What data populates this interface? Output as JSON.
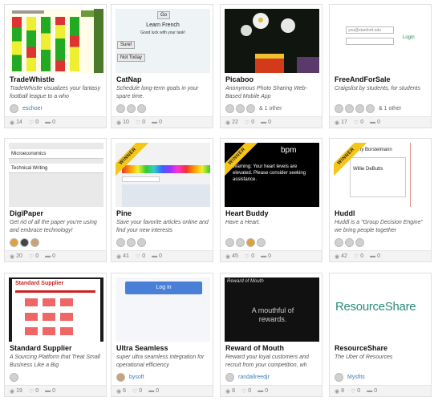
{
  "cards": [
    {
      "title": "TradeWhistle",
      "desc": "TradeWhistle visualizes your fantasy football league to a who",
      "user": "eschoer",
      "views": "14",
      "likes": "0",
      "comments": "0"
    },
    {
      "title": "CatNap",
      "desc": "Schedule long-term goals in your spare time.",
      "thumb": {
        "go": "Go",
        "heading": "Learn French",
        "sub": "Good luck with your task!",
        "sure": "Sure!",
        "nottoday": "Not Today"
      },
      "views": "10",
      "likes": "0",
      "comments": "0"
    },
    {
      "title": "Picaboo",
      "desc": "Anonymous Photo Sharing Web-Based Mobile App",
      "others": "& 1 other",
      "views": "22",
      "likes": "0",
      "comments": "0"
    },
    {
      "title": "FreeAndForSale",
      "desc": "Craigslist by students, for students",
      "thumb": {
        "email": "you@stanford.edu",
        "login": "Login"
      },
      "others": "& 1 other",
      "views": "17",
      "likes": "0",
      "comments": "0"
    },
    {
      "title": "DigiPaper",
      "desc": "Get rid of all the paper you're using and embrace technology!",
      "thumb": {
        "line1": "Microeconomics",
        "line2": "Technical Writing"
      },
      "views": "20",
      "likes": "0",
      "comments": "0"
    },
    {
      "title": "Pine",
      "desc": "Save your favorite articles online and find your new interests",
      "ribbon": "WINNER",
      "views": "41",
      "likes": "0",
      "comments": "0"
    },
    {
      "title": "Heart Buddy",
      "desc": "Have a Heart.",
      "ribbon": "WINNER",
      "thumb": {
        "bpm": "bpm",
        "warn": "Warning: Your heart levels are elevated. Please consider seeking assistance."
      },
      "views": "45",
      "likes": "0",
      "comments": "0"
    },
    {
      "title": "Huddl",
      "desc": "Huddl is a \"Group Decision Engine\" we bring people together",
      "ribbon": "WINNER",
      "thumb": {
        "name1": "Danny Borstelmann",
        "name2": "Willie DeButts"
      },
      "views": "42",
      "likes": "0",
      "comments": "0"
    },
    {
      "title": "Standard Supplier",
      "desc": "A Sourcing Platform that Treat Small Business Like a Big",
      "thumb": {
        "logo": "Standard Supplier"
      },
      "views": "19",
      "likes": "0",
      "comments": "0"
    },
    {
      "title": "Ultra Seamless",
      "desc": "super ultra seamless integration for operational efficiency",
      "thumb": {
        "login": "Log in"
      },
      "user": "bysoft",
      "views": "6",
      "likes": "0",
      "comments": "0"
    },
    {
      "title": "Reward of Mouth",
      "desc": "Reward your loyal customers and recruit from your competition, wh",
      "thumb": {
        "brand": "Reward of Mouth",
        "tagline": "A mouthful of rewards."
      },
      "user": "randallreedjr",
      "views": "8",
      "likes": "0",
      "comments": "0"
    },
    {
      "title": "ResourceShare",
      "desc": "The Uber of Resources",
      "thumb": {
        "logo": "ResourceShare"
      },
      "user": "Mysfits",
      "views": "8",
      "likes": "0",
      "comments": "0"
    }
  ]
}
